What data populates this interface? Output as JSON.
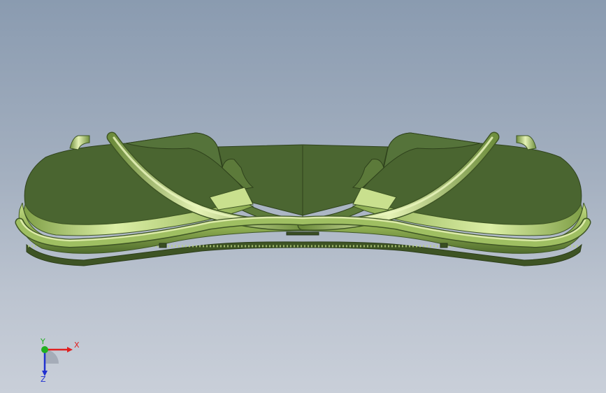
{
  "viewport": {
    "background_top": "#8a9bb0",
    "background_bottom": "#c9cfd9"
  },
  "model": {
    "color_dark": "#4a6530",
    "color_mid": "#5c7a3a",
    "color_light": "#a6c86a",
    "color_highlight": "#e2f0b0"
  },
  "triad": {
    "x_label": "X",
    "y_label": "Y",
    "z_label": "Z",
    "x_color": "#e02020",
    "y_color": "#20b020",
    "z_color": "#2030d0"
  }
}
